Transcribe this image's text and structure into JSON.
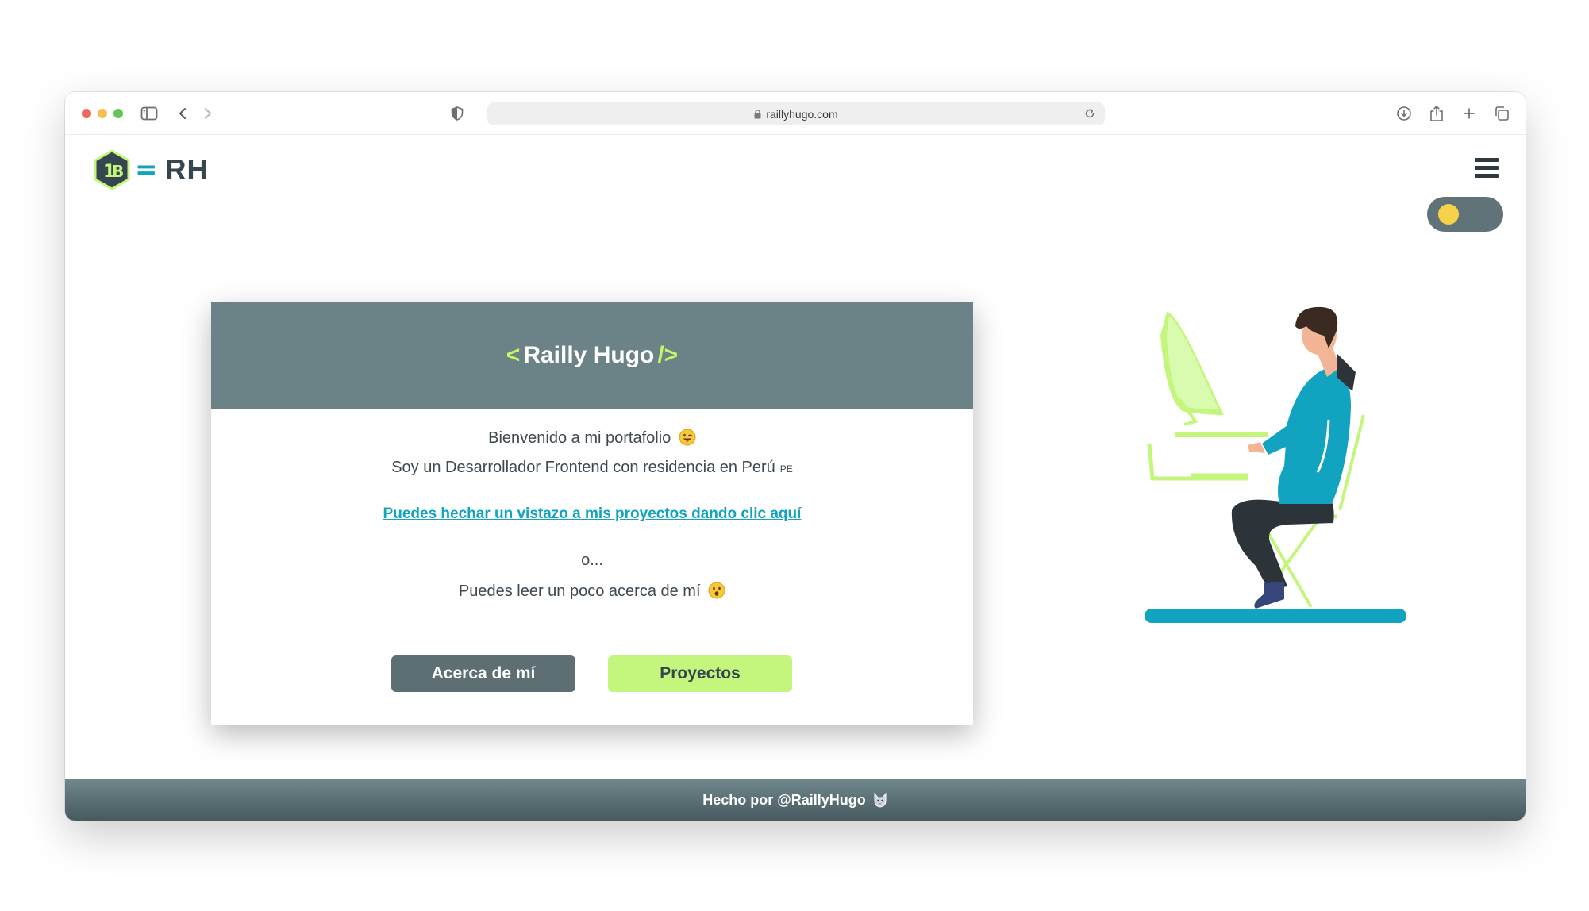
{
  "browser": {
    "url": "raillyhugo.com"
  },
  "header": {
    "logo_text": "RH",
    "logo_separator": "="
  },
  "card": {
    "title_open_tag": "<",
    "title_name": "Railly Hugo",
    "title_close_tag": "/>",
    "welcome": "Bienvenido a mi portafolio",
    "intro": "Soy un Desarrollador Frontend con residencia en Perú",
    "flag": "PE",
    "projects_link": "Puedes hechar un vistazo a mis proyectos dando clic aquí",
    "or": "o...",
    "about_text": "Puedes leer un poco acerca de mí",
    "about_button": "Acerca de mí",
    "projects_button": "Proyectos"
  },
  "footer": {
    "text": "Hecho por @RaillyHugo"
  },
  "theme": {
    "accent": "#11a3bf",
    "lime": "#c4f57d",
    "header_bg": "#6b8386",
    "dark": "#36464f",
    "toggle_state": "light"
  }
}
